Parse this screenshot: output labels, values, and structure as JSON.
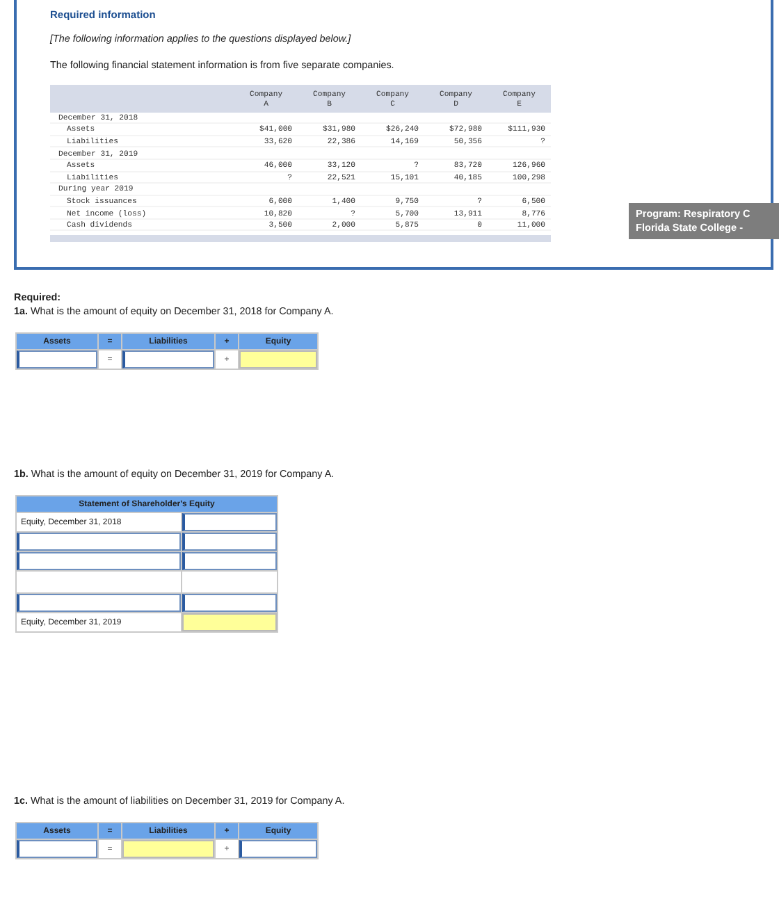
{
  "info": {
    "heading": "Required information",
    "note": "[The following information applies to the questions displayed below.]",
    "intro": "The following financial statement information is from five separate companies.",
    "table": {
      "columns": [
        {
          "line1": "Company",
          "line2": "A"
        },
        {
          "line1": "Company",
          "line2": "B"
        },
        {
          "line1": "Company",
          "line2": "C"
        },
        {
          "line1": "Company",
          "line2": "D"
        },
        {
          "line1": "Company",
          "line2": "E"
        }
      ],
      "rows": [
        {
          "kind": "section",
          "label": "December 31, 2018"
        },
        {
          "kind": "item",
          "label": "Assets",
          "values": [
            "$41,000",
            "$31,980",
            "$26,240",
            "$72,980",
            "$111,930"
          ]
        },
        {
          "kind": "item",
          "label": "Liabilities",
          "values": [
            "33,620",
            "22,386",
            "14,169",
            "50,356",
            "?"
          ]
        },
        {
          "kind": "section",
          "label": "December 31, 2019"
        },
        {
          "kind": "item",
          "label": "Assets",
          "values": [
            "46,000",
            "33,120",
            "?",
            "83,720",
            "126,960"
          ]
        },
        {
          "kind": "item",
          "label": "Liabilities",
          "values": [
            "?",
            "22,521",
            "15,101",
            "40,185",
            "100,298"
          ]
        },
        {
          "kind": "section",
          "label": "During year 2019"
        },
        {
          "kind": "item",
          "label": "Stock issuances",
          "values": [
            "6,000",
            "1,400",
            "9,750",
            "?",
            "6,500"
          ]
        },
        {
          "kind": "item",
          "label": "Net income (loss)",
          "values": [
            "10,820",
            "?",
            "5,700",
            "13,911",
            "8,776"
          ]
        },
        {
          "kind": "item",
          "label": "Cash dividends",
          "values": [
            "3,500",
            "2,000",
            "5,875",
            "0",
            "11,000"
          ]
        }
      ]
    }
  },
  "tooltip": [
    "Program: Respiratory C",
    "Florida State College -"
  ],
  "required_label": "Required:",
  "questions": [
    {
      "kind": "equation",
      "number": "1a.",
      "text": "What is the amount of equity on December 31, 2018 for Company A.",
      "headers": [
        "Assets",
        "=",
        "Liabilities",
        "+",
        "Equity"
      ],
      "cells": [
        {
          "kind": "input"
        },
        {
          "kind": "op",
          "text": "="
        },
        {
          "kind": "input"
        },
        {
          "kind": "op",
          "text": "+"
        },
        {
          "kind": "answer"
        }
      ]
    },
    {
      "kind": "statement",
      "number": "1b.",
      "text": "What is the amount of equity on December 31, 2019 for Company A.",
      "title": "Statement of Shareholder's Equity",
      "rows": [
        {
          "label": {
            "kind": "text",
            "text": "Equity, December 31, 2018"
          },
          "value": {
            "kind": "input"
          }
        },
        {
          "label": {
            "kind": "input"
          },
          "value": {
            "kind": "input"
          }
        },
        {
          "label": {
            "kind": "input"
          },
          "value": {
            "kind": "input"
          }
        },
        {
          "label": {
            "kind": "blank"
          },
          "value": {
            "kind": "blank"
          }
        },
        {
          "label": {
            "kind": "input"
          },
          "value": {
            "kind": "input"
          }
        },
        {
          "label": {
            "kind": "text",
            "text": "Equity, December 31, 2019"
          },
          "value": {
            "kind": "answer"
          }
        }
      ]
    },
    {
      "kind": "equation",
      "number": "1c.",
      "text": "What is the amount of liabilities on December 31, 2019 for Company A.",
      "headers": [
        "Assets",
        "=",
        "Liabilities",
        "+",
        "Equity"
      ],
      "cells": [
        {
          "kind": "input"
        },
        {
          "kind": "op",
          "text": "="
        },
        {
          "kind": "answer"
        },
        {
          "kind": "op",
          "text": "+"
        },
        {
          "kind": "input"
        }
      ]
    }
  ]
}
